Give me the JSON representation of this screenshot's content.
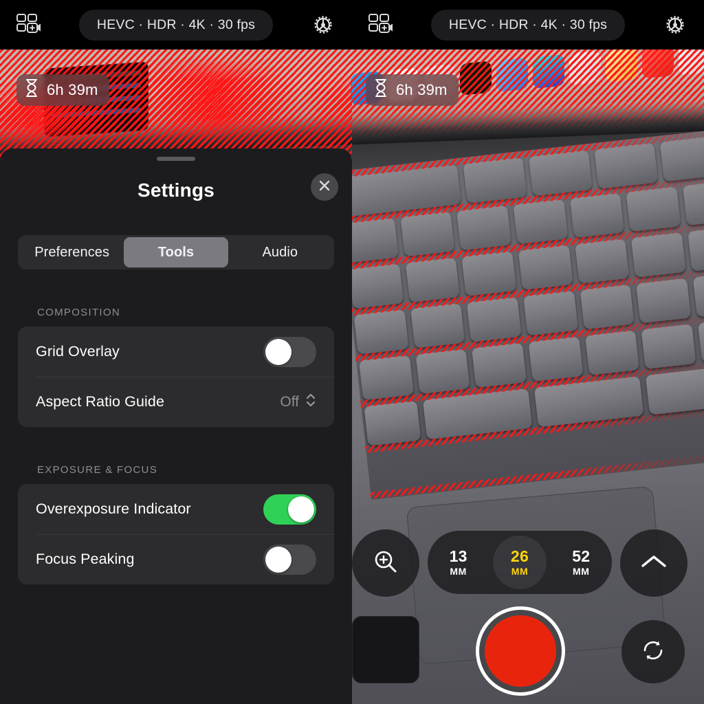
{
  "topbar": {
    "left": {
      "multicam_icon": "multicam-add-icon",
      "format_pill": "HEVC · HDR · 4K · 30 fps",
      "settings_icon": "gear-icon"
    },
    "right": {
      "multicam_icon": "multicam-add-icon",
      "format_pill": "HEVC · HDR · 4K · 30 fps",
      "settings_icon": "gear-icon"
    }
  },
  "preview_overlay": {
    "screen_time_icon": "hourglass-icon",
    "screen_time_left": "6h 39m",
    "screen_time_right": "6h 39m"
  },
  "settings_sheet": {
    "title": "Settings",
    "close_icon": "close-icon",
    "grabber": "drag-handle",
    "tabs": [
      {
        "label": "Preferences",
        "active": false
      },
      {
        "label": "Tools",
        "active": true
      },
      {
        "label": "Audio",
        "active": false
      }
    ],
    "sections": [
      {
        "header": "COMPOSITION",
        "rows": [
          {
            "label": "Grid Overlay",
            "control": "toggle",
            "value": "off"
          },
          {
            "label": "Aspect Ratio Guide",
            "control": "picker",
            "value": "Off",
            "icon": "chevron-up-down-icon"
          }
        ]
      },
      {
        "header": "EXPOSURE & FOCUS",
        "rows": [
          {
            "label": "Overexposure Indicator",
            "control": "toggle",
            "value": "on"
          },
          {
            "label": "Focus Peaking",
            "control": "toggle",
            "value": "off"
          }
        ]
      }
    ]
  },
  "camera_controls": {
    "magnify_icon": "magnifier-plus-icon",
    "lens_options": [
      {
        "num": "13",
        "unit": "MM",
        "active": false
      },
      {
        "num": "26",
        "unit": "MM",
        "active": true
      },
      {
        "num": "52",
        "unit": "MM",
        "active": false
      }
    ],
    "more_lens_icon": "chevron-up-icon",
    "record_button": "record-button",
    "flip_icon": "camera-flip-icon",
    "gallery_thumb": "gallery-thumbnail"
  },
  "colors": {
    "accent_yellow": "#ffd60a",
    "record_red": "#e8250c",
    "toggle_on_green": "#2fd257",
    "sheet_bg": "#1c1c1e",
    "group_bg": "#2c2c2e",
    "zebra_red": "#ff1616"
  }
}
